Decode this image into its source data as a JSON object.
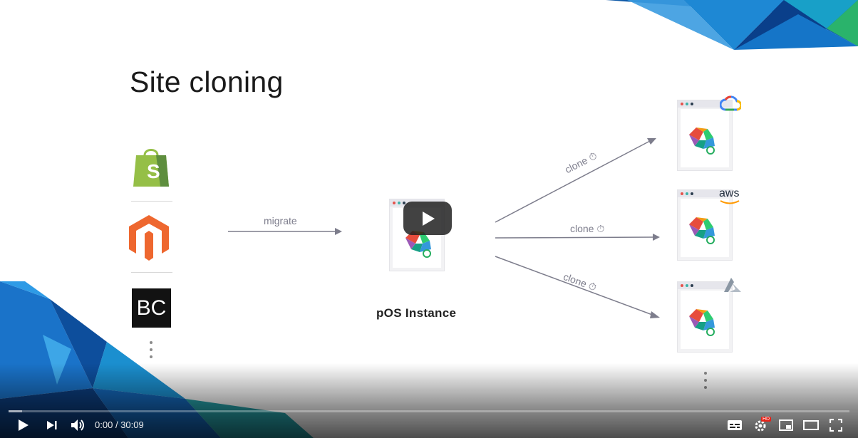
{
  "slide": {
    "title": "Site cloning",
    "migrate_label": "migrate",
    "clone_label_top": "clone",
    "clone_label_mid": "clone",
    "clone_label_bottom": "clone",
    "instance_label": "pOS Instance",
    "sources": [
      {
        "name": "shopify-logo",
        "letter": "S",
        "color": "#95bf47"
      },
      {
        "name": "magento-logo",
        "letter": "M",
        "color": "#ee672f"
      },
      {
        "name": "bigcommerce-logo",
        "letter": "BC",
        "color": "#121212"
      }
    ],
    "clouds": [
      {
        "name": "google-cloud-logo"
      },
      {
        "name": "aws-logo",
        "text": "aws"
      },
      {
        "name": "azure-logo"
      }
    ],
    "accent_colors": {
      "arrow": "#7d7d8c",
      "browser_dot_red": "#e5534b",
      "browser_dot_teal": "#3bb3a9",
      "browser_dot_dark": "#2c3e50"
    }
  },
  "player": {
    "current_time": "0:00",
    "separator": "/",
    "duration": "30:09",
    "progress": 0.0,
    "loaded_fraction": 0.016,
    "controls": [
      "play-icon",
      "next-icon",
      "volume-icon",
      "subtitles-icon",
      "settings-hd-icon",
      "miniplayer-icon",
      "theater-icon",
      "fullscreen-icon"
    ],
    "hd_badge": "HD"
  }
}
